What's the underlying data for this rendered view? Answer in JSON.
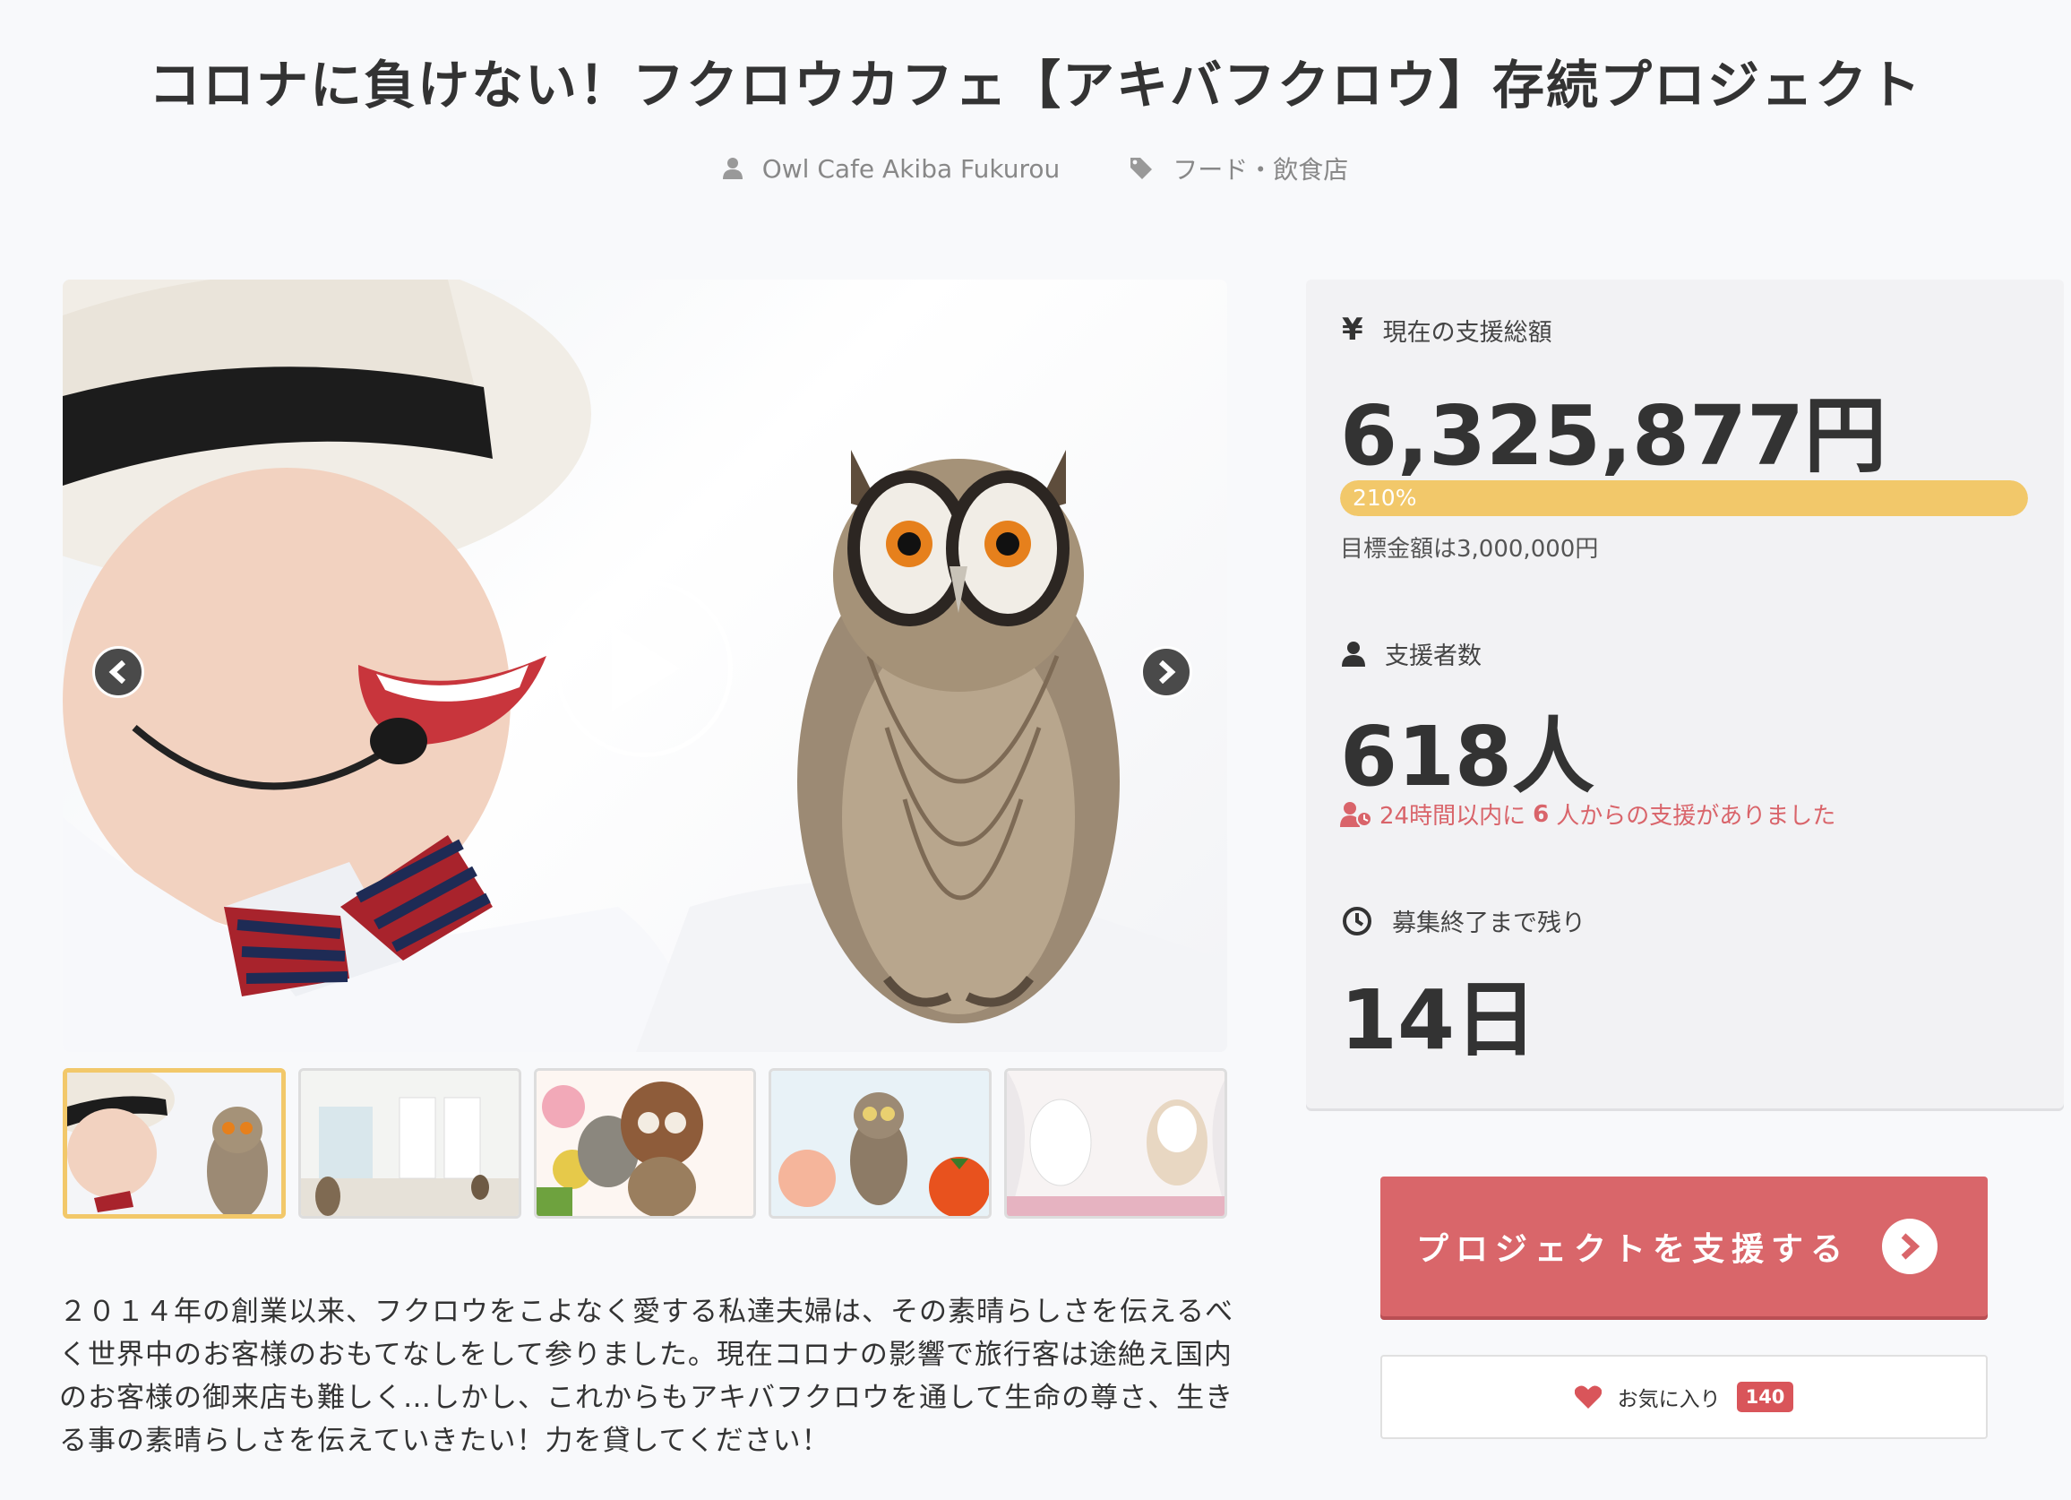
{
  "page": {
    "title": "コロナに負けない！フクロウカフェ【アキバフクロウ】存続プロジェクト",
    "owner": "Owl Cafe Akiba Fukurou",
    "category": "フード・飲食店"
  },
  "media": {
    "play_icon": "play-icon",
    "prev_icon": "chevron-left-icon",
    "next_icon": "chevron-right-icon",
    "thumbnail_count": 5,
    "active_thumbnail": 1
  },
  "description": "２０１４年の創業以来、フクロウをこよなく愛する私達夫婦は、その素晴らしさを伝えるべく世界中のお客様のおもてなしをして参りました。現在コロナの影響で旅行客は途絶え国内のお客様の御来店も難しく…しかし、これからもアキバフクロウを通して生命の尊さ、生きる事の素晴らしさを伝えていきたい！力を貸してください！",
  "stats": {
    "amount_label": "現在の支援総額",
    "amount_value": "6,325,877円",
    "progress_label": "210%",
    "progress_fraction": 1.0,
    "goal_text": "目標金額は3,000,000円",
    "supporters_label": "支援者数",
    "supporters_value": "618人",
    "recent_prefix": "24時間以内に",
    "recent_count": "6",
    "recent_suffix": "人からの支援がありました",
    "remaining_label": "募集終了まで残り",
    "remaining_value": "14日"
  },
  "actions": {
    "support_label": "プロジェクトを支援する",
    "favorite_label": "お気に入り",
    "favorite_count": "140"
  },
  "colors": {
    "accent": "#d9666a",
    "progress": "#f2c86a",
    "alert": "#d9646a"
  }
}
